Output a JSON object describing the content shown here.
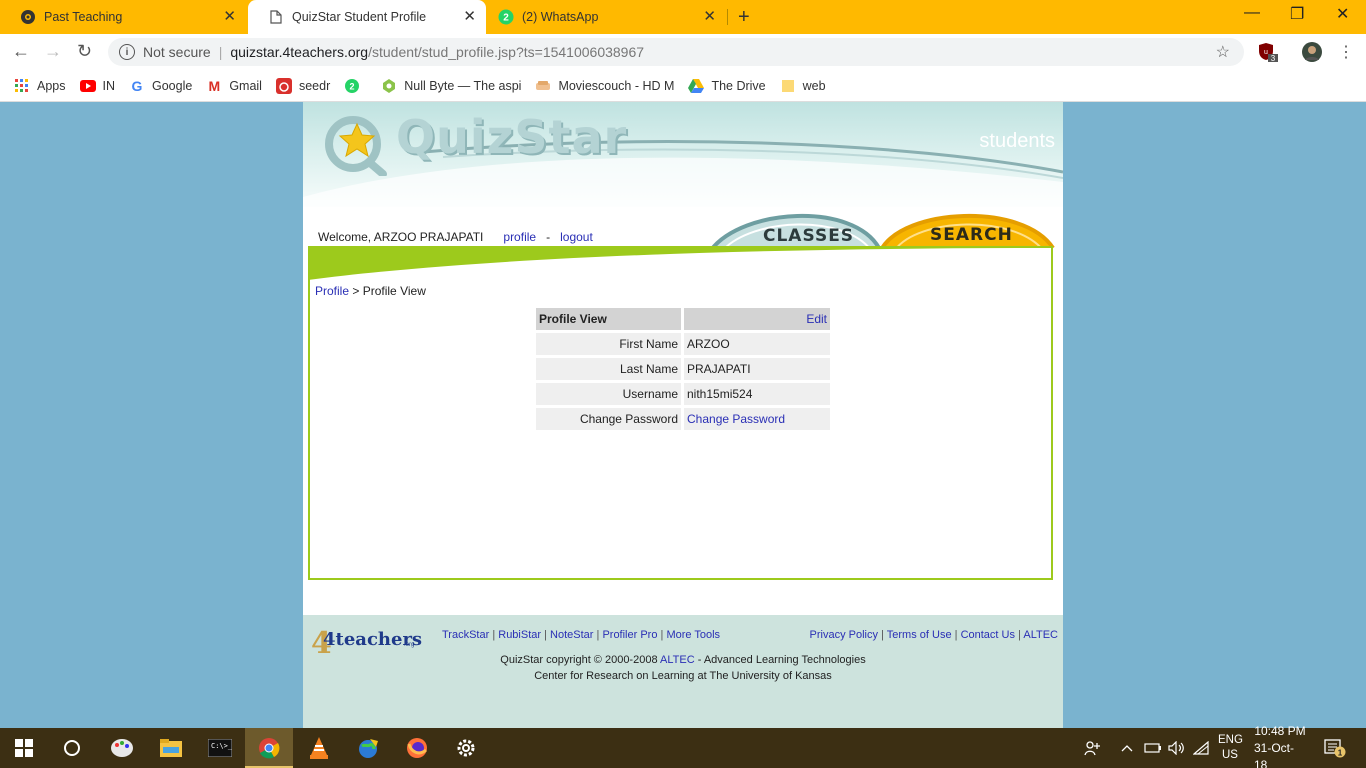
{
  "browser": {
    "tabs": [
      {
        "title": "Past Teaching"
      },
      {
        "title": "QuizStar Student Profile"
      },
      {
        "title": "(2) WhatsApp",
        "badge": "2"
      }
    ],
    "address": {
      "security": "Not secure",
      "host": "quizstar.4teachers.org",
      "path": "/student/stud_profile.jsp?ts=1541006038967"
    },
    "extension_badge": "3",
    "bookmarks": [
      {
        "label": "Apps",
        "icon": "apps-grid-icon"
      },
      {
        "label": "IN",
        "icon": "youtube-icon"
      },
      {
        "label": "Google",
        "icon": "google-icon"
      },
      {
        "label": "Gmail",
        "icon": "gmail-icon"
      },
      {
        "label": "seedr",
        "icon": "seedr-icon"
      },
      {
        "label": "",
        "icon": "whatsapp-icon",
        "badge": "2"
      },
      {
        "label": "Null Byte — The aspi",
        "icon": "null-byte-icon"
      },
      {
        "label": "Moviescouch - HD M",
        "icon": "moviescouch-icon"
      },
      {
        "label": "The Drive",
        "icon": "google-drive-icon"
      },
      {
        "label": "web",
        "icon": "folder-icon"
      }
    ]
  },
  "site": {
    "logo_text": "QuizStar",
    "section": "students",
    "tabs": {
      "classes": "CLASSES",
      "search": "SEARCH"
    },
    "welcome": "Welcome, ARZOO PRAJAPATI",
    "profile_link": "profile",
    "dash": "-",
    "logout_link": "logout",
    "breadcrumb": {
      "link": "Profile",
      "separator": ">",
      "current": "Profile View"
    }
  },
  "profile": {
    "header": "Profile View",
    "edit": "Edit",
    "rows": [
      {
        "label": "First Name",
        "value": "ARZOO"
      },
      {
        "label": "Last Name",
        "value": "PRAJAPATI"
      },
      {
        "label": "Username",
        "value": "nith15mi524"
      },
      {
        "label": "Change Password",
        "value": "Change Password"
      }
    ]
  },
  "footer": {
    "brand": "4teachers",
    "brand_suffix": ".org",
    "tools": [
      "TrackStar",
      "RubiStar",
      "NoteStar",
      "Profiler Pro",
      "More Tools"
    ],
    "links": [
      "Privacy Policy",
      "Terms of Use",
      "Contact Us",
      "ALTEC"
    ],
    "copyright_prefix": "QuizStar copyright © 2000-2008",
    "copyright_link": "ALTEC",
    "copyright_suffix": "- Advanced Learning Technologies",
    "center": "Center for Research on Learning at The University of Kansas"
  },
  "taskbar": {
    "lang_top": "ENG",
    "lang_bottom": "US",
    "time": "10:48 PM",
    "date": "31-Oct-18",
    "notification_count": "1"
  }
}
